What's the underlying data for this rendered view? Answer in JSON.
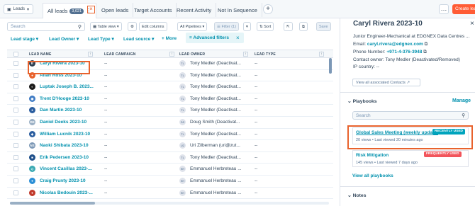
{
  "topbar": {
    "object_select": "Leads",
    "tabs": [
      {
        "label": "All leads",
        "badge": "3,021"
      },
      {
        "label": "Open leads"
      },
      {
        "label": "Target Accounts"
      },
      {
        "label": "Recent Activity"
      },
      {
        "label": "Not In Sequence"
      }
    ],
    "create_label": "Create lea"
  },
  "toolbar": {
    "search_placeholder": "Search",
    "table_view": "Table view",
    "edit_columns": "Edit columns",
    "pipelines": "All Pipelines",
    "filter": "Filter (1)",
    "sort": "Sort",
    "save": "Save"
  },
  "filters": {
    "lead_stage": "Lead stage",
    "lead_owner": "Lead Owner",
    "lead_type": "Lead Type",
    "lead_source": "Lead source",
    "more": "+ More",
    "advanced": "Advanced filters"
  },
  "table": {
    "columns": [
      "LEAD NAME",
      "LEAD CAMPAIGN",
      "LEAD OWNER",
      "LEAD TYPE"
    ],
    "rows": [
      {
        "name": "Caryl Rivera 2023-10",
        "campaign": "--",
        "owner": "Tony Medler (Deactivat...",
        "owner_initials": "TL",
        "type": "--",
        "logo": "E",
        "logo_color": "#2d3e50"
      },
      {
        "name": "Allan Ross 2023-10",
        "campaign": "--",
        "owner": "Tony Medler (Deactivat...",
        "owner_initials": "TL",
        "type": "--",
        "logo": "●",
        "logo_color": "#e8622d"
      },
      {
        "name": "Luptak Joseph B. 2023...",
        "campaign": "--",
        "owner": "Tony Medler (Deactivat...",
        "owner_initials": "TL",
        "type": "--",
        "logo": "◐",
        "logo_color": "#1b1b1b"
      },
      {
        "name": "Trent D'Hooge 2023-10",
        "campaign": "--",
        "owner": "Tony Medler (Deactivat...",
        "owner_initials": "TL",
        "type": "--",
        "logo": "◉",
        "logo_color": "#3e7bc4"
      },
      {
        "name": "Dan Martin 2023-10",
        "campaign": "--",
        "owner": "Tony Medler (Deactivat...",
        "owner_initials": "TL",
        "type": "--",
        "logo": "●",
        "logo_color": "#2a5d9f"
      },
      {
        "name": "Daniel Deeks 2023-10",
        "campaign": "--",
        "owner": "Doug Smith (Deactivat...",
        "owner_initials": "DS",
        "type": "--",
        "logo": "DE",
        "logo_color": "#99afc4"
      },
      {
        "name": "William Lucnik 2023-10",
        "campaign": "--",
        "owner": "Tony Medler (Deactivat...",
        "owner_initials": "TL",
        "type": "--",
        "logo": "◈",
        "logo_color": "#2a5d9f"
      },
      {
        "name": "Naoki Shibata 2023-10",
        "campaign": "--",
        "owner": "Uri Zilberman (uri@zut...",
        "owner_initials": "UZ",
        "type": "--",
        "logo": "NS",
        "logo_color": "#7c98b6"
      },
      {
        "name": "Erik Pedersen 2023-10",
        "campaign": "--",
        "owner": "Tony Medler (Deactivat...",
        "owner_initials": "TL",
        "type": "--",
        "logo": "■",
        "logo_color": "#1e4f8a"
      },
      {
        "name": "Vincent Casillas 2023-...",
        "campaign": "--",
        "owner": "Emmanuel Herbreteau ...",
        "owner_initials": "EH",
        "type": "--",
        "logo": "◇",
        "logo_color": "#3aa9b3"
      },
      {
        "name": "Craig Prunty 2023-10",
        "campaign": "--",
        "owner": "Emmanuel Herbreteau ...",
        "owner_initials": "EH",
        "type": "--",
        "logo": "●",
        "logo_color": "#2a8ed6"
      },
      {
        "name": "Nicolas Bedouin 2023-...",
        "campaign": "--",
        "owner": "Emmanuel Herbreteau ...",
        "owner_initials": "EH",
        "type": "--",
        "logo": "●",
        "logo_color": "#c0392b"
      }
    ]
  },
  "sidebar": {
    "title": "Caryl Rivera 2023-10",
    "job": "Junior Engineer-Mechanical at EDGNEX Data Centres ...",
    "email_label": "Email:",
    "email": "caryl.rivera@edgnex.com",
    "phone_label": "Phone Number:",
    "phone": "+971-4-376-3948",
    "owner": "Contact owner: Tony Medler (Deactivated/Removed)",
    "ip": "IP country: --",
    "view_contacts": "View all associated Contacts",
    "playbooks_heading": "Playbooks",
    "manage": "Manage",
    "pb_search_placeholder": "Search",
    "playbooks": [
      {
        "title": "Global Sales Meeting (weekly update)",
        "sub": "20 views • Last viewed 20 minutes ago",
        "tag": "RECENTLY USED",
        "tag_color": "#00a4bd"
      },
      {
        "title": "Risk Mitigation",
        "sub": "145 views • Last viewed 7 days ago",
        "tag": "FREQUENTLY USED",
        "tag_color": "#f2545b"
      }
    ],
    "view_all": "View all playbooks",
    "notes_heading": "Notes"
  }
}
